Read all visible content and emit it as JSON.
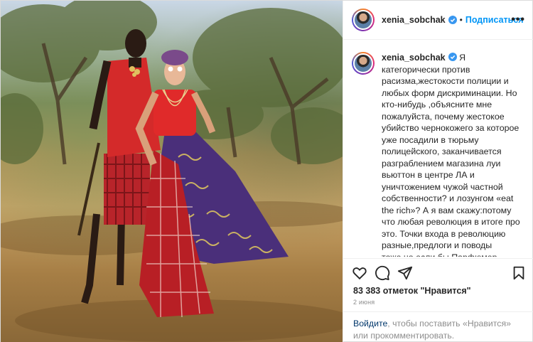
{
  "post": {
    "username": "xenia_sobchak",
    "follow_label": "Подписаться",
    "more_label": "•••",
    "caption": "Я категорически против расизма,жестокости полиции и любых форм дискриминации. Но кто-нибудь ,объясните мне пожалуйста, почему жестокое убийство чернокожего за которое уже посадили в тюрьму полицейского, заканчивается разграблением магазина луи вьюттон в центре ЛА и уничтожением чужой частной собственности? и лозунгом «eat the rich»? А я вам скажу:потому что любая революция в итоге про это. Точки входа в революцию разные,предлоги и поводы тоже,но если бы Парфюмер Зюскинда сделал бы дистиллированную выжимку из «Революции» то остался бы ничем незамутненный",
    "likes": "83 383 отметок \"Нравится\"",
    "date": "2 июня",
    "login_link": "Войдите",
    "login_text": ", чтобы поставить «Нравится» или прокомментировать."
  },
  "icons": {
    "verified": "verified-badge-icon",
    "like": "heart-icon",
    "comment": "comment-icon",
    "share": "share-icon",
    "save": "bookmark-icon"
  },
  "colors": {
    "link": "#0095f6",
    "text": "#262626",
    "muted": "#8e8e8e",
    "border": "#efefef"
  }
}
